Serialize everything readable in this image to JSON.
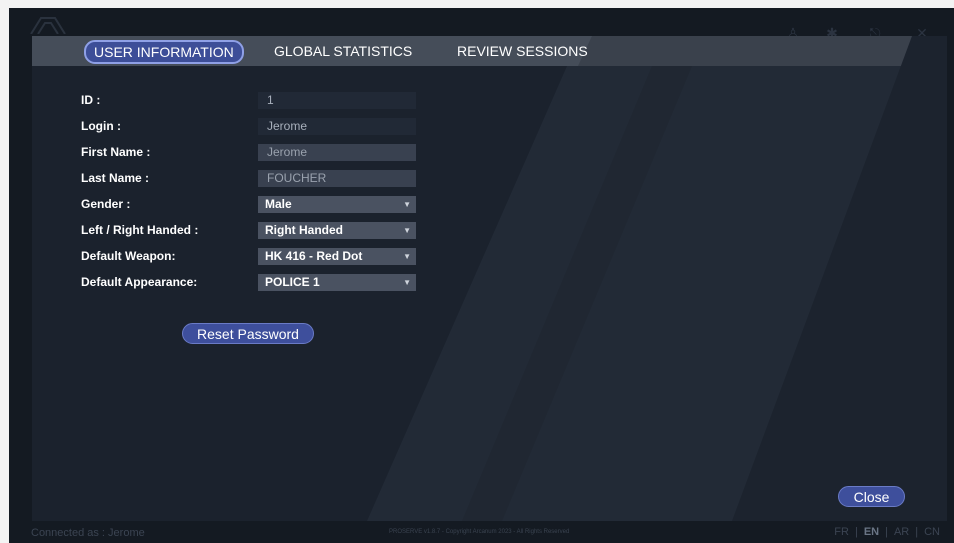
{
  "tabs": [
    {
      "label": "USER INFORMATION",
      "active": true
    },
    {
      "label": "GLOBAL STATISTICS",
      "active": false
    },
    {
      "label": "REVIEW SESSIONS",
      "active": false
    }
  ],
  "form": {
    "id_label": "ID :",
    "id_value": "1",
    "login_label": "Login :",
    "login_value": "Jerome",
    "first_name_label": "First Name :",
    "first_name_value": "Jerome",
    "last_name_label": "Last Name :",
    "last_name_value": "FOUCHER",
    "gender_label": "Gender :",
    "gender_value": "Male",
    "handed_label": "Left / Right Handed :",
    "handed_value": "Right Handed",
    "weapon_label": "Default Weapon:",
    "weapon_value": "HK 416 - Red Dot",
    "appearance_label": "Default Appearance:",
    "appearance_value": "POLICE 1",
    "caret": "▼"
  },
  "buttons": {
    "reset_password": "Reset Password",
    "close": "Close"
  },
  "status": {
    "connected": "Connected as : Jerome",
    "copyright": "PROSERVE v1.8.7 - Copyright Arcanum 2023 - All Rights Reserved",
    "languages": [
      "FR",
      "EN",
      "AR",
      "CN"
    ],
    "active_language": "EN"
  },
  "colors": {
    "accent": "#3e4f9c",
    "panel": "#1b222d",
    "background": "#141a22"
  }
}
